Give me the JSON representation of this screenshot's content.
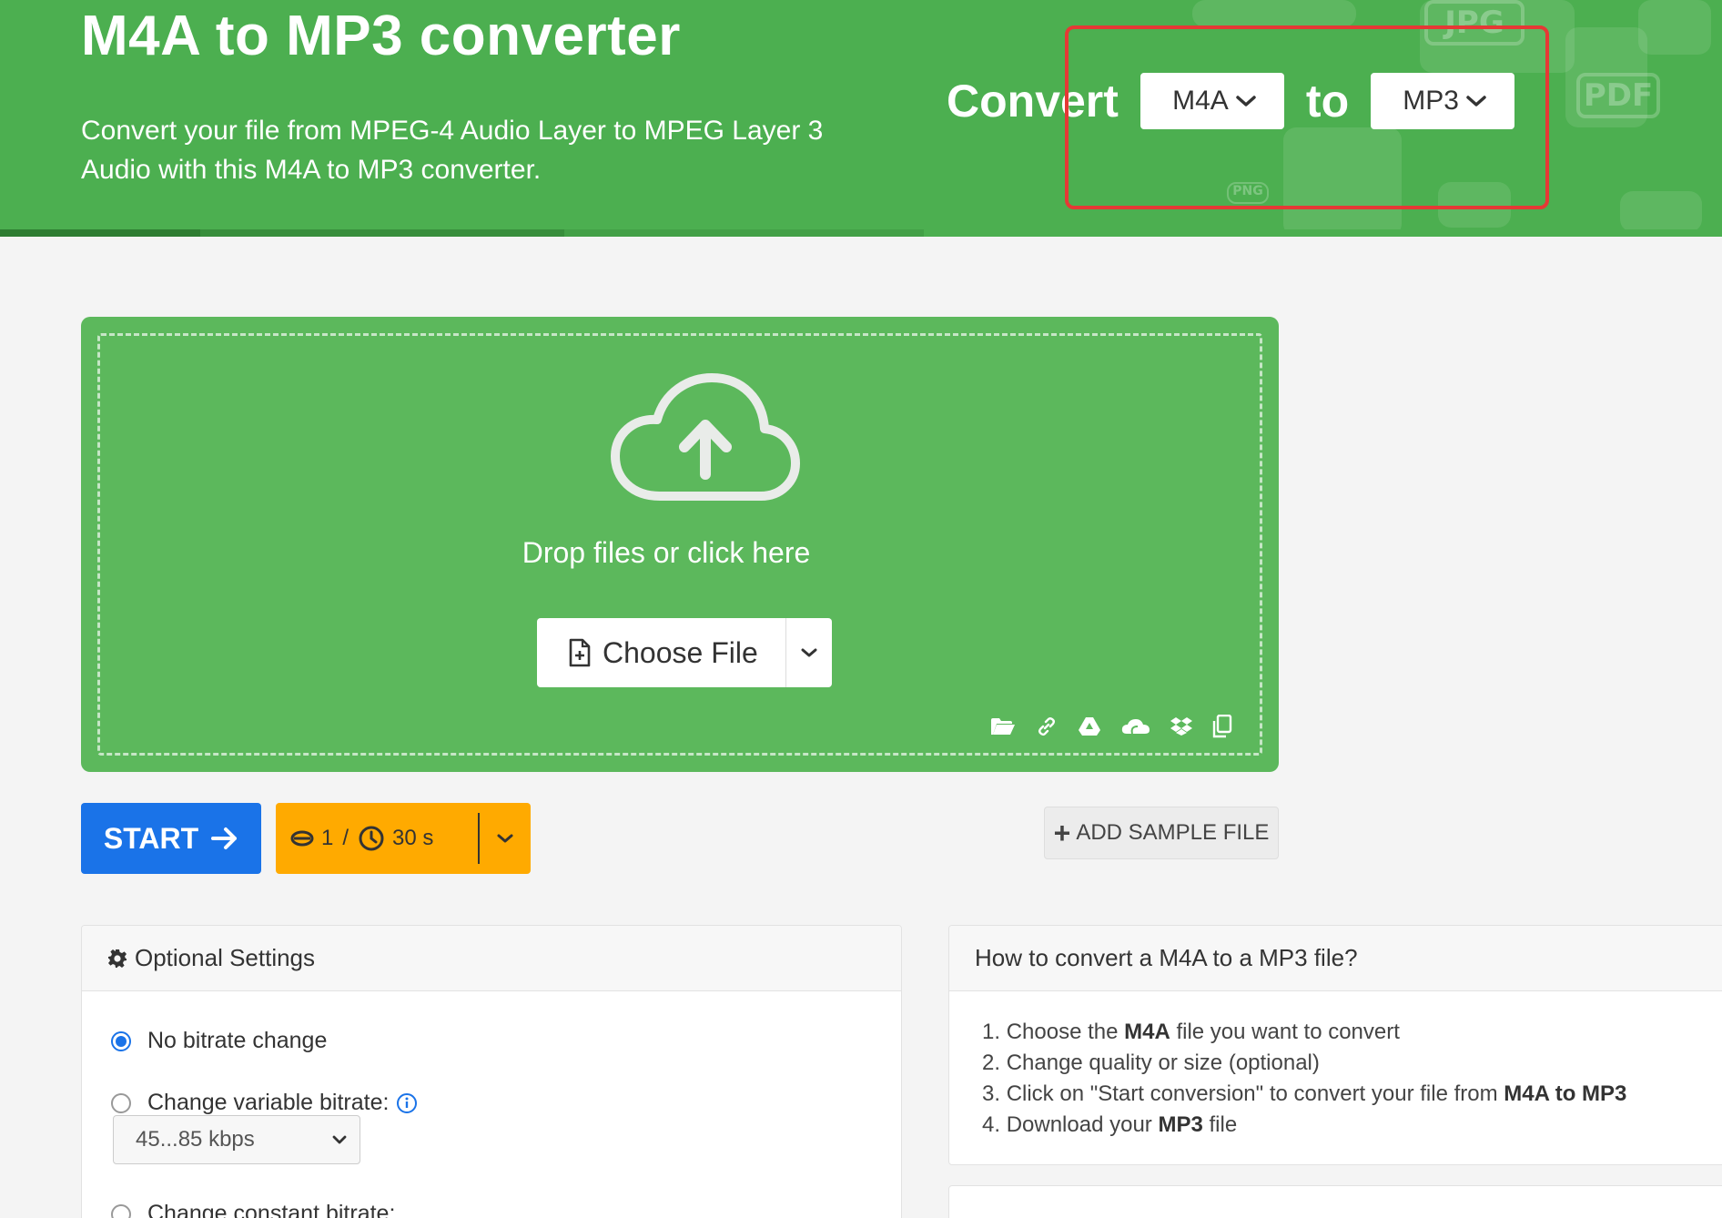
{
  "header": {
    "title": "M4A to MP3 converter",
    "subtitle": "Convert your file from MPEG-4 Audio Layer to MPEG Layer 3 Audio with this M4A to MP3 converter.",
    "convert_label": "Convert",
    "to_label": "to",
    "from_format": "M4A",
    "to_format": "MP3",
    "bg_tags": [
      "JPG",
      "PDF",
      "PNG"
    ]
  },
  "dropzone": {
    "text": "Drop files or click here",
    "choose_label": "Choose File",
    "sources": [
      "folder-icon",
      "link-icon",
      "google-drive-icon",
      "onedrive-icon",
      "dropbox-icon",
      "clipboard-icon"
    ]
  },
  "actions": {
    "start_label": "START",
    "credits_count": "1",
    "credits_sep": "/",
    "credits_time": "30 s",
    "sample_label": "ADD SAMPLE FILE"
  },
  "settings": {
    "title": "Optional Settings",
    "options": [
      {
        "label": "No bitrate change",
        "checked": true
      },
      {
        "label": "Change variable bitrate:",
        "checked": false
      },
      {
        "label": "Change constant bitrate:",
        "checked": false
      }
    ],
    "vbr_value": "45...85 kbps"
  },
  "howto": {
    "title": "How to convert a M4A to a MP3 file?",
    "steps": [
      {
        "num": "1.",
        "pre": "Choose the ",
        "bold": "M4A",
        "post": " file you want to convert"
      },
      {
        "num": "2.",
        "pre": "Change quality or size (optional)",
        "bold": "",
        "post": ""
      },
      {
        "num": "3.",
        "pre": "Click on \"Start conversion\" to convert your file from ",
        "bold": "M4A to MP3",
        "post": ""
      },
      {
        "num": "4.",
        "pre": "Download your ",
        "bold": "MP3",
        "post": " file"
      }
    ]
  },
  "colors": {
    "brand_green": "#4caf50",
    "start_blue": "#1a73e8",
    "credits_orange": "#ffaa00",
    "highlight_red": "#e53935"
  }
}
